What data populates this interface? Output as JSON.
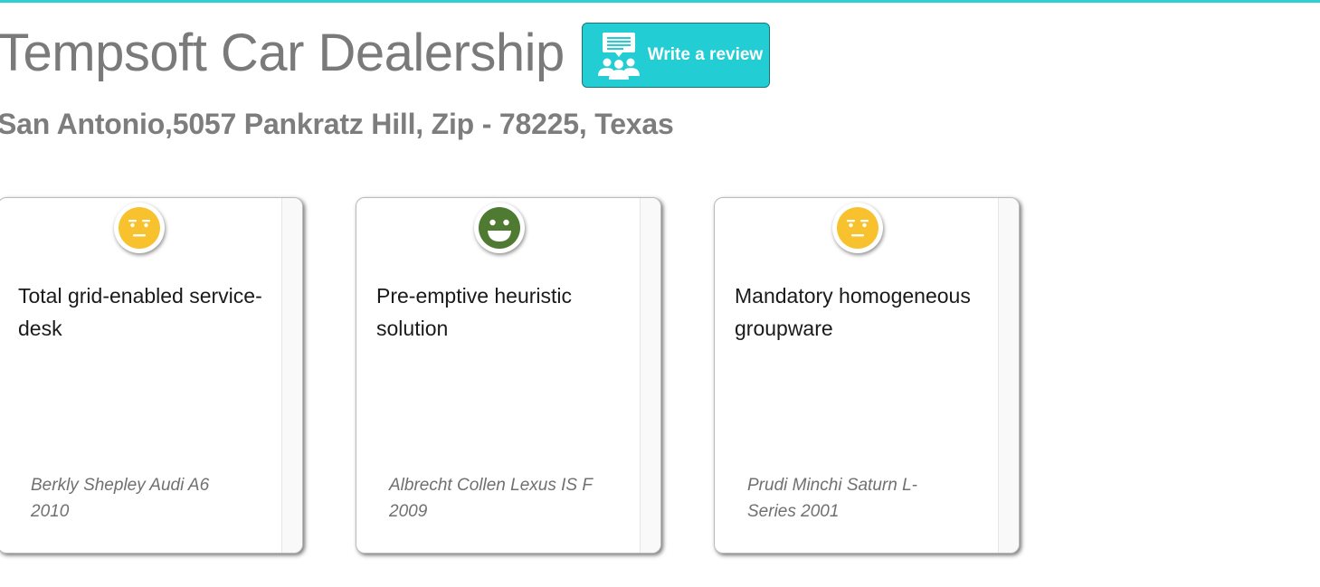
{
  "page": {
    "title": "Tempsoft Car Dealership",
    "address": "San Antonio,5057 Pankratz Hill, Zip - 78225, Texas",
    "accent_color": "#22ced3"
  },
  "review_button": {
    "label": "Write a review",
    "icon": "group-review-icon"
  },
  "reviews": [
    {
      "sentiment": "neutral",
      "face_icon": "neutral-face-icon",
      "face_color": "#f8c22e",
      "text": "Total grid-enabled service-desk",
      "reviewer": "Berkly Shepley Audi A6 2010"
    },
    {
      "sentiment": "positive",
      "face_icon": "happy-face-icon",
      "face_color": "#4f7a31",
      "text": "Pre-emptive heuristic solution",
      "reviewer": "Albrecht Collen Lexus IS F 2009"
    },
    {
      "sentiment": "neutral",
      "face_icon": "neutral-face-icon",
      "face_color": "#f8c22e",
      "text": "Mandatory homogeneous groupware",
      "reviewer": "Prudi Minchi Saturn L-Series 2001"
    }
  ]
}
